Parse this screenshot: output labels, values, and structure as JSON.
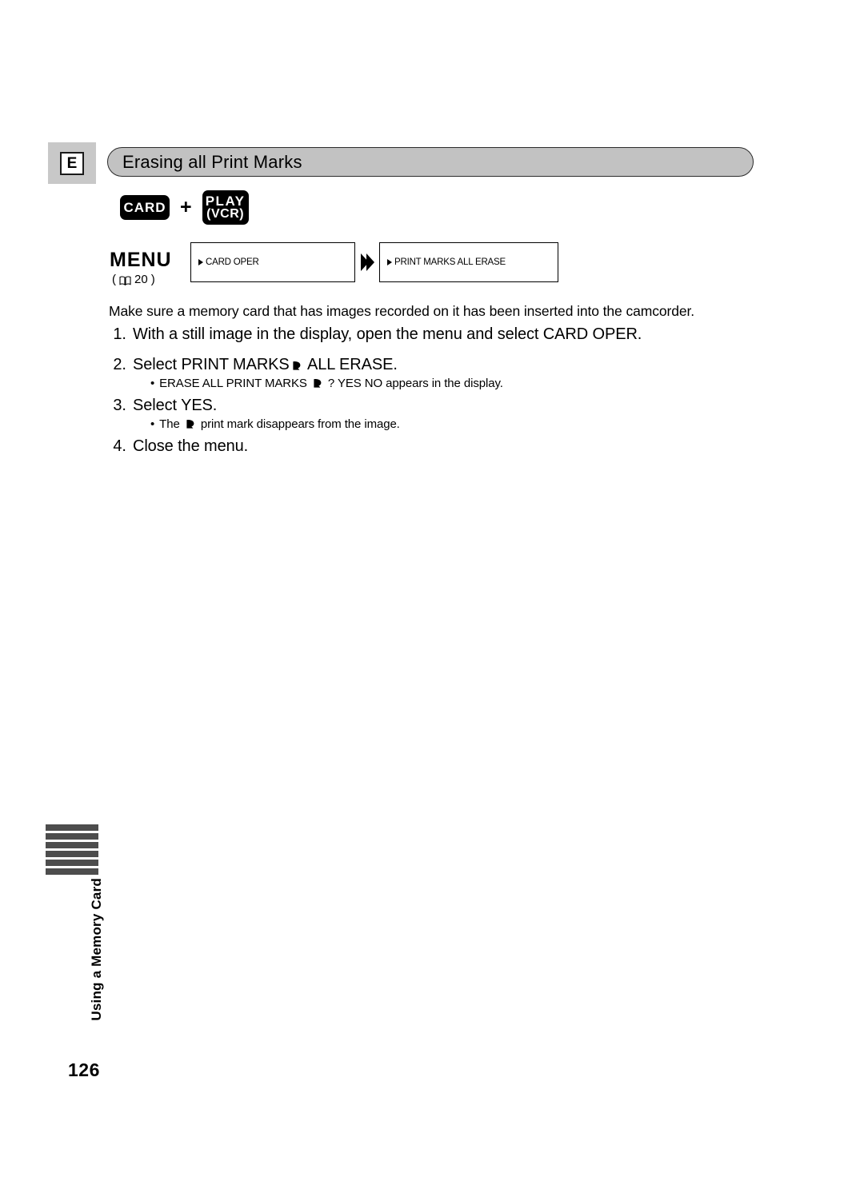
{
  "page": {
    "language_marker": "E",
    "page_number": "126",
    "side_tab_label": "Using a Memory Card",
    "side_tab_bar_count": 6
  },
  "section": {
    "title": "Erasing all Print Marks"
  },
  "mode_buttons": {
    "card_label": "CARD",
    "plus": "+",
    "play_line1": "PLAY",
    "play_line2": "(VCR)"
  },
  "menu": {
    "label": "MENU",
    "reference_open": "(",
    "reference_icon": "book-icon",
    "reference_page": "20",
    "reference_close": ")",
    "boxes": [
      {
        "arrow": "▶",
        "text": "CARD OPER"
      },
      {
        "arrow": "▶",
        "text": "PRINT MARKS ALL ERASE"
      }
    ],
    "flow_arrow": "double-chevron"
  },
  "body": {
    "intro": "Make sure a memory card that has images recorded on it has been inserted into the camcorder.",
    "steps": [
      {
        "number": "1.",
        "text": "With a still image in the display, open the menu and select CARD OPER.",
        "bullets": []
      },
      {
        "number": "2.",
        "text_before_mark": "Select PRINT MARKS",
        "text_after_mark": " ALL ERASE.",
        "bullets": [
          {
            "before_mark": "ERASE ALL PRINT MARKS ",
            "after_mark": " ? YES NO appears in the display."
          }
        ]
      },
      {
        "number": "3.",
        "text": "Select YES.",
        "bullets": [
          {
            "before_mark": "The ",
            "after_mark": " print mark disappears from the image."
          }
        ]
      },
      {
        "number": "4.",
        "text": "Close the menu.",
        "bullets": []
      }
    ],
    "bullet_char": "•"
  },
  "colors": {
    "title_bar_bg": "#c2c2c2",
    "lang_block_bg": "#c8c8c8",
    "tab_bar": "#4d4d4d",
    "button_bg": "#000000",
    "button_text": "#ffffff"
  }
}
